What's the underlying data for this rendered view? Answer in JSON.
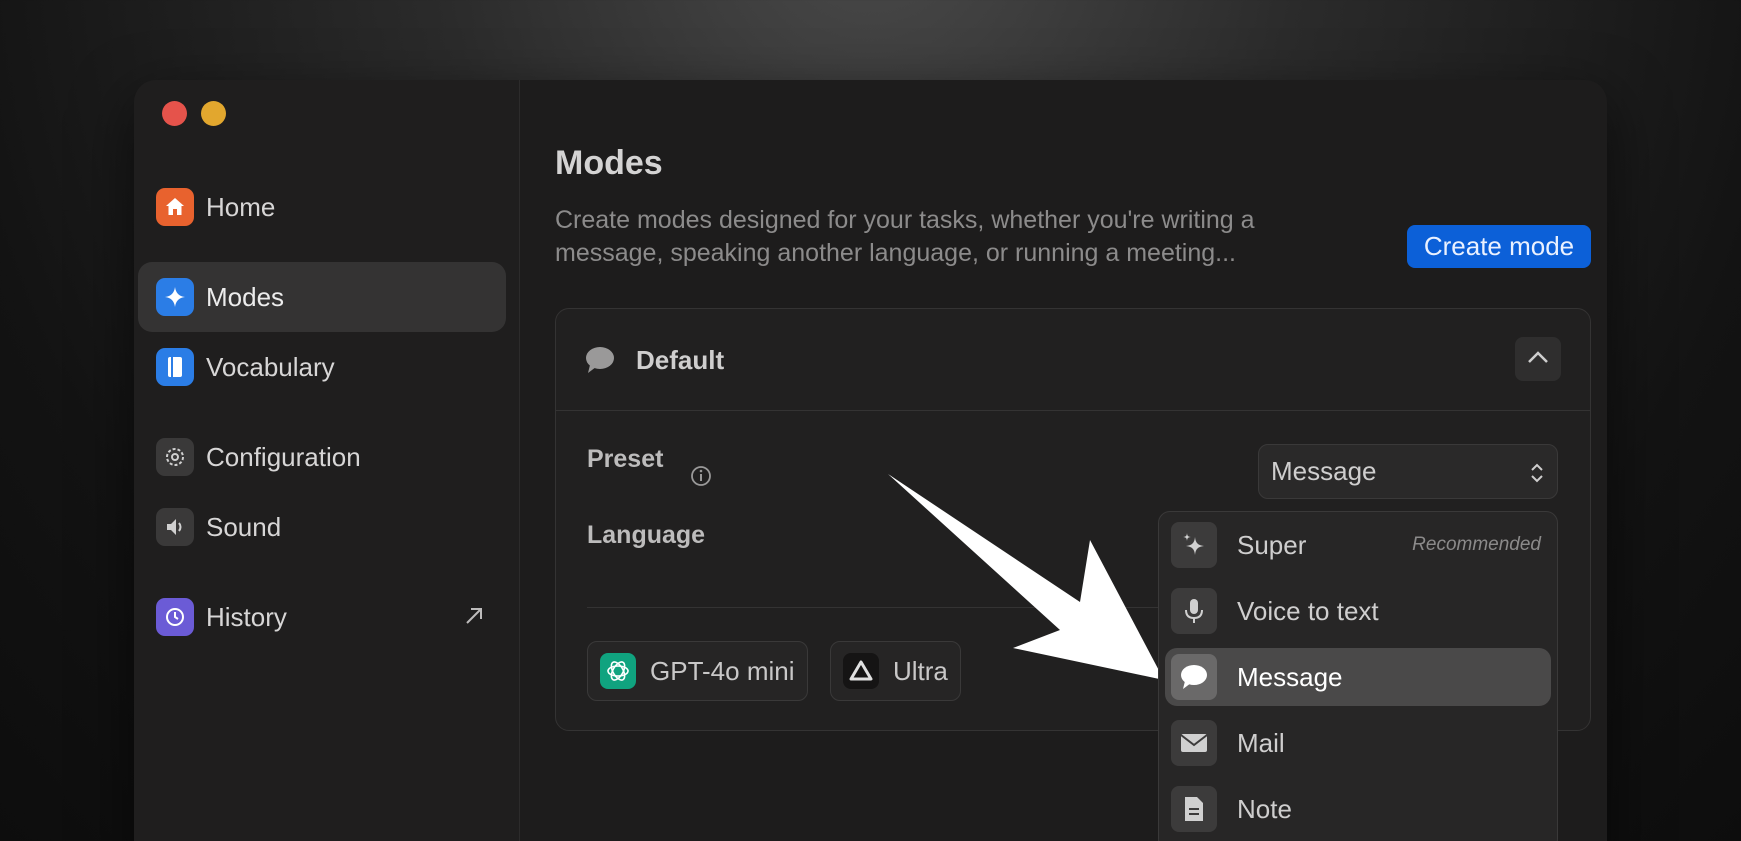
{
  "sidebar": {
    "items": [
      {
        "label": "Home",
        "icon": "home-icon",
        "color": "#e8622e"
      },
      {
        "label": "Modes",
        "icon": "sparkle-icon",
        "color": "#2b7de6"
      },
      {
        "label": "Vocabulary",
        "icon": "book-icon",
        "color": "#2b7de6"
      },
      {
        "label": "Configuration",
        "icon": "gear-icon",
        "color": "#3a3939"
      },
      {
        "label": "Sound",
        "icon": "speaker-icon",
        "color": "#3a3939"
      },
      {
        "label": "History",
        "icon": "history-icon",
        "color": "#6b5bd6"
      }
    ]
  },
  "main": {
    "title": "Modes",
    "description": "Create modes designed for your tasks, whether you're writing a message, speaking another language, or running a meeting...",
    "create_button": "Create mode"
  },
  "card": {
    "title": "Default",
    "preset_label": "Preset",
    "preset_value": "Message",
    "language_label": "Language",
    "chips": [
      {
        "label": "GPT-4o mini",
        "icon": "openai-icon"
      },
      {
        "label": "Ultra",
        "icon": "ultra-icon"
      }
    ]
  },
  "dropdown": {
    "items": [
      {
        "label": "Super",
        "icon": "sparkles-icon",
        "badge": "Recommended"
      },
      {
        "label": "Voice to text",
        "icon": "microphone-icon"
      },
      {
        "label": "Message",
        "icon": "speech-bubble-icon",
        "selected": true
      },
      {
        "label": "Mail",
        "icon": "envelope-icon"
      },
      {
        "label": "Note",
        "icon": "document-icon"
      }
    ]
  }
}
